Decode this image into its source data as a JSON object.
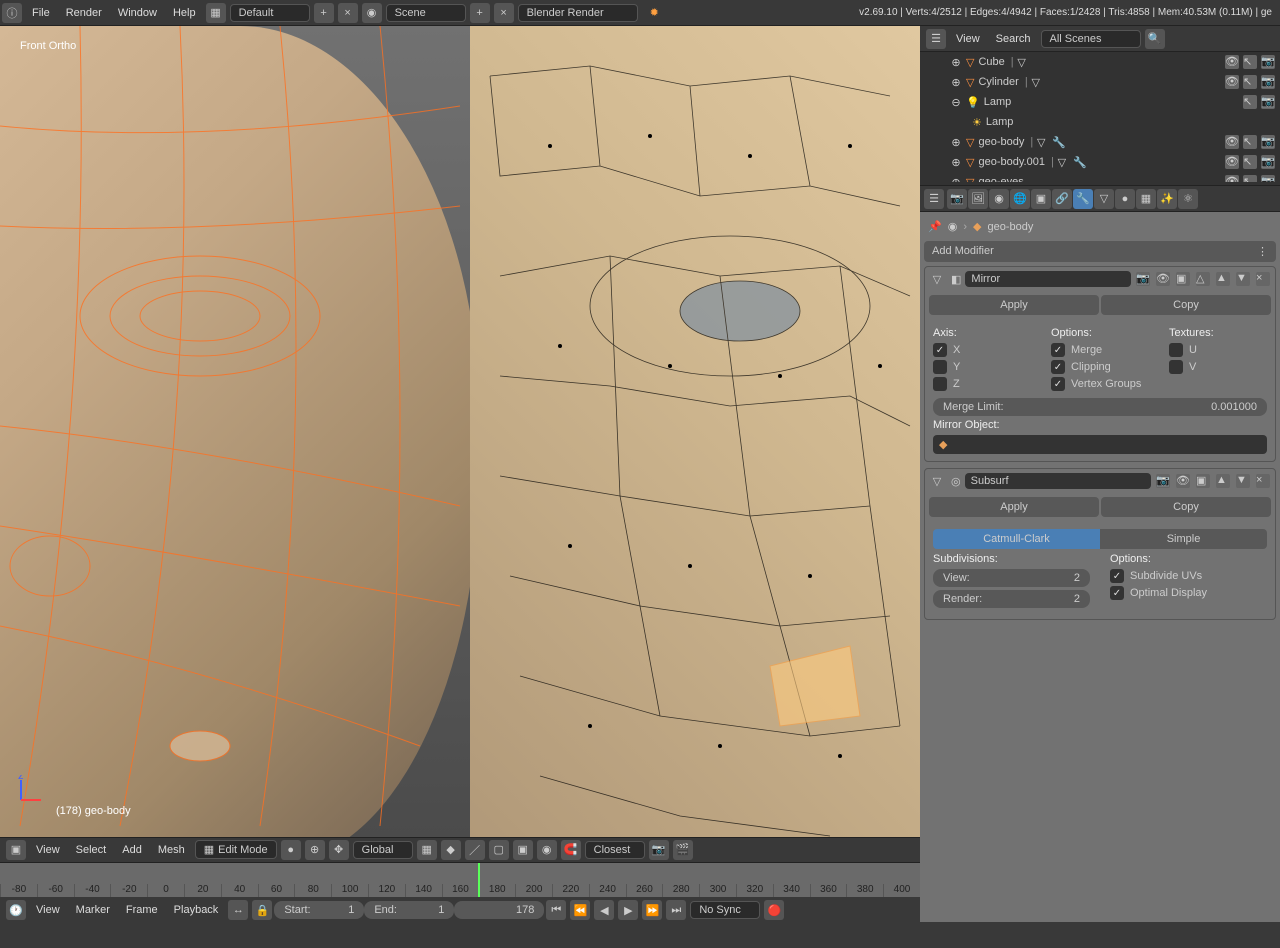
{
  "topbar": {
    "menus": [
      "File",
      "Render",
      "Window",
      "Help"
    ],
    "layout_label": "Default",
    "scene_label": "Scene",
    "renderer_label": "Blender Render",
    "stats": "v2.69.10 | Verts:4/2512 | Edges:4/4942 | Faces:1/2428 | Tris:4858 | Mem:40.53M (0.11M) | ge"
  },
  "viewport": {
    "label": "Front Ortho",
    "object_label": "(178) geo-body",
    "header": {
      "menus": [
        "View",
        "Select",
        "Add",
        "Mesh"
      ],
      "mode": "Edit Mode",
      "orientation": "Global",
      "snap": "Closest"
    }
  },
  "outliner": {
    "header": {
      "view": "View",
      "search": "Search",
      "filter": "All Scenes"
    },
    "items": [
      {
        "name": "Cube",
        "type": "mesh",
        "indent": 1
      },
      {
        "name": "Cylinder",
        "type": "mesh",
        "indent": 1
      },
      {
        "name": "Lamp",
        "type": "lamp",
        "indent": 1
      },
      {
        "name": "Lamp",
        "type": "lampdata",
        "indent": 2
      },
      {
        "name": "geo-body",
        "type": "mesh",
        "indent": 1,
        "mods": true
      },
      {
        "name": "geo-body.001",
        "type": "mesh",
        "indent": 1,
        "mods": true
      },
      {
        "name": "geo-eyes",
        "type": "mesh",
        "indent": 1
      }
    ]
  },
  "properties": {
    "breadcrumb": "geo-body",
    "add_modifier": "Add Modifier",
    "modifiers": [
      {
        "name": "Mirror",
        "icon": "mirror",
        "apply": "Apply",
        "copy": "Copy",
        "axis_label": "Axis:",
        "options_label": "Options:",
        "textures_label": "Textures:",
        "axis": {
          "X": true,
          "Y": false,
          "Z": false
        },
        "options": {
          "Merge": true,
          "Clipping": true,
          "Vertex Groups": true
        },
        "textures": {
          "U": false,
          "V": false
        },
        "merge_limit_label": "Merge Limit:",
        "merge_limit": "0.001000",
        "mirror_object_label": "Mirror Object:"
      },
      {
        "name": "Subsurf",
        "icon": "subsurf",
        "apply": "Apply",
        "copy": "Copy",
        "type_a": "Catmull-Clark",
        "type_b": "Simple",
        "subdivisions_label": "Subdivisions:",
        "options_label": "Options:",
        "view_label": "View:",
        "view_val": "2",
        "render_label": "Render:",
        "render_val": "2",
        "subdivide_uvs": "Subdivide UVs",
        "optimal_display": "Optimal Display"
      }
    ]
  },
  "timeline": {
    "ticks": [
      "-80",
      "-60",
      "-40",
      "-20",
      "0",
      "20",
      "40",
      "60",
      "80",
      "100",
      "120",
      "140",
      "160",
      "180",
      "200",
      "220",
      "240",
      "260",
      "280",
      "300",
      "320",
      "340",
      "360",
      "380",
      "400"
    ],
    "cursor_frame": 178,
    "header": {
      "menus": [
        "View",
        "Marker",
        "Frame",
        "Playback"
      ],
      "start_label": "Start:",
      "start": "1",
      "end_label": "End:",
      "end": "1",
      "current": "178",
      "sync": "No Sync"
    }
  }
}
